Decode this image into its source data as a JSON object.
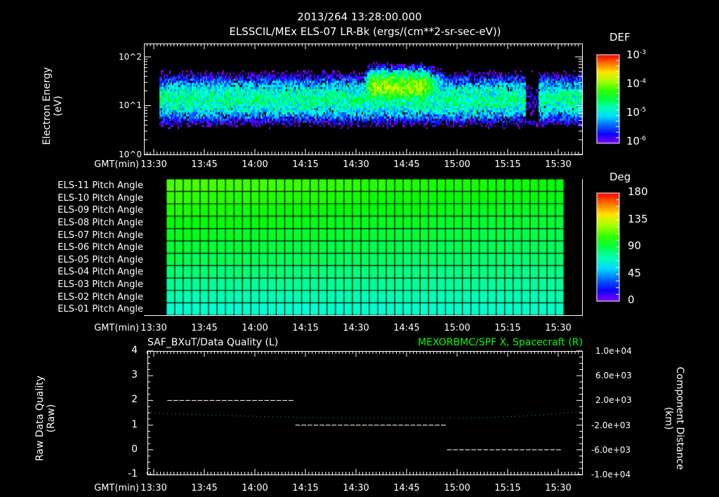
{
  "header": {
    "time_title": "2013/264 13:28:00.000",
    "subtitle": "ELSSCIL/MEx ELS-07 LR-Bk  (ergs/(cm**2-sr-sec-eV))"
  },
  "time_axis": {
    "label": "GMT(min)",
    "ticks": [
      "13:30",
      "13:45",
      "14:00",
      "14:15",
      "14:30",
      "14:45",
      "15:00",
      "15:15",
      "15:30"
    ]
  },
  "chart_data": [
    {
      "type": "heatmap",
      "title": "ELSSCIL/MEx ELS-07 LR-Bk  (ergs/(cm**2-sr-sec-eV))",
      "ylabel": "Electron Energy",
      "ylabel_units": "(eV)",
      "yscale": "log",
      "ylim": [
        1,
        185
      ],
      "y_ticks": [
        "10^0",
        "10^1",
        "10^2"
      ],
      "xlabel": "GMT(min)",
      "xlim_minutes_after_1330": [
        -3,
        127
      ],
      "colorbar": {
        "label": "DEF",
        "scale": "log",
        "range": [
          1e-06,
          0.001
        ],
        "ticks": [
          "10^-3",
          "10^-4",
          "10^-5",
          "10^-6"
        ]
      },
      "features": [
        {
          "start_min": 2,
          "end_min": 127,
          "peak_energy_ev": 14,
          "peak_def": 2e-05
        },
        {
          "start_min": 61,
          "end_min": 90,
          "peak_energy_ev": 25,
          "peak_def": 0.00012
        },
        {
          "start_min": 110,
          "end_min": 114,
          "peak_energy_ev": 14,
          "peak_def": 1e-06
        }
      ]
    },
    {
      "type": "heatmap",
      "rows": [
        "ELS-11 Pitch Angle",
        "ELS-10 Pitch Angle",
        "ELS-09 Pitch Angle",
        "ELS-08 Pitch Angle",
        "ELS-07 Pitch Angle",
        "ELS-06 Pitch Angle",
        "ELS-05 Pitch Angle",
        "ELS-04 Pitch Angle",
        "ELS-03 Pitch Angle",
        "ELS-02 Pitch Angle",
        "ELS-01 Pitch Angle"
      ],
      "start_min": 3.7,
      "end_min": 121.7,
      "columns": 47,
      "pitch_angle_deg_start": [
        112,
        108,
        104,
        100,
        96,
        92,
        88,
        82,
        77,
        72,
        67
      ],
      "pitch_angle_deg_end": [
        100,
        97,
        94,
        91,
        88,
        85,
        82,
        79,
        76,
        72,
        69
      ],
      "colorbar": {
        "label": "Deg",
        "range": [
          0,
          180
        ],
        "ticks": [
          "180",
          "135",
          "90",
          "45",
          "0"
        ]
      }
    },
    {
      "type": "line",
      "left_title": "SAF_BXuT/Data Quality (L)",
      "right_title": "MEXORBMC/SPF X, Spacecraft (R)",
      "ylabel_left": "Raw Data Quality",
      "ylabel_left_units": "(Raw)",
      "ylabel_right": "Component Distance",
      "ylabel_right_units": "(km)",
      "ylim_left": [
        -1,
        4
      ],
      "y_ticks_left": [
        "4",
        "3",
        "2",
        "1",
        "0",
        "-1"
      ],
      "ylim_right": [
        -10000,
        10000
      ],
      "y_ticks_right": [
        "1.0e+04",
        "6.0e+03",
        "2.0e+03",
        "-2.0e+03",
        "-6.0e+03",
        "-1.0e+04"
      ],
      "series": [
        {
          "name": "Data Quality",
          "color": "#ffffff",
          "segments": [
            [
              4,
              41,
              2
            ],
            [
              42,
              86,
              1
            ],
            [
              87,
              121,
              0
            ]
          ]
        },
        {
          "name": "Spacecraft X",
          "color": "#00ff00",
          "x_min": [
            -3,
            5,
            15,
            25,
            35,
            45,
            55,
            65,
            75,
            85,
            95,
            105,
            115,
            127
          ],
          "y_km": [
            0,
            -150,
            -350,
            -500,
            -650,
            -750,
            -850,
            -900,
            -900,
            -900,
            -850,
            -650,
            -350,
            200
          ]
        }
      ]
    }
  ],
  "colors": {
    "title_green": "#00ff00",
    "axis": "#ffffff",
    "background": "#000000"
  }
}
